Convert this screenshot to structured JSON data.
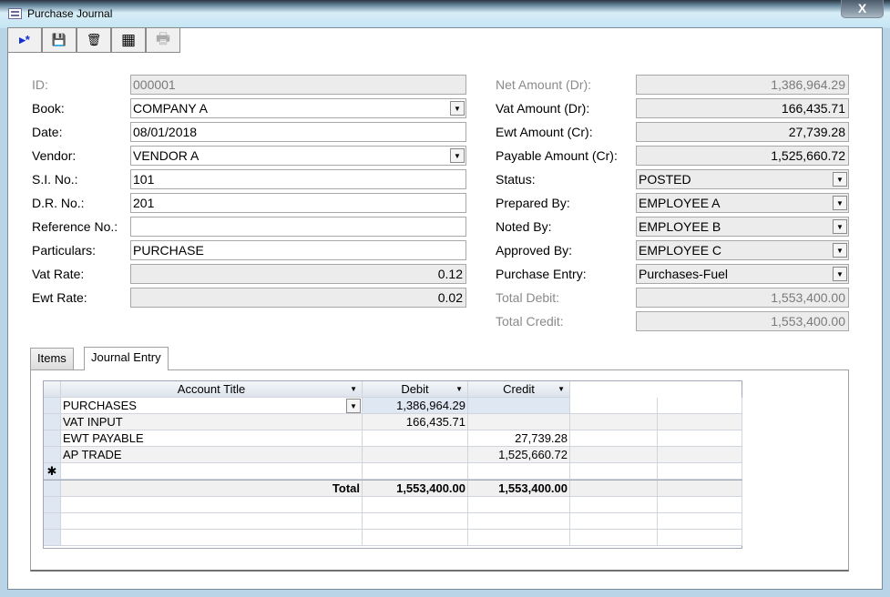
{
  "window": {
    "title": "Purchase Journal",
    "close": "X"
  },
  "toolbar": [
    {
      "name": "new-record",
      "glyph": "▸*"
    },
    {
      "name": "save",
      "glyph": "💾"
    },
    {
      "name": "delete",
      "glyph": "🗑"
    },
    {
      "name": "datasheet",
      "glyph": "▦"
    },
    {
      "name": "print",
      "glyph": "🖶"
    }
  ],
  "left": {
    "id": {
      "label": "ID:",
      "value": "000001"
    },
    "book": {
      "label": "Book:",
      "value": "COMPANY A"
    },
    "date": {
      "label": "Date:",
      "value": "08/01/2018"
    },
    "vendor": {
      "label": "Vendor:",
      "value": "VENDOR A"
    },
    "si": {
      "label": "S.I. No.:",
      "value": "101"
    },
    "dr": {
      "label": "D.R. No.:",
      "value": "201"
    },
    "ref": {
      "label": "Reference No.:",
      "value": ""
    },
    "particulars": {
      "label": "Particulars:",
      "value": "PURCHASE"
    },
    "vat": {
      "label": "Vat Rate:",
      "value": "0.12"
    },
    "ewt": {
      "label": "Ewt Rate:",
      "value": "0.02"
    }
  },
  "right": {
    "net": {
      "label": "Net Amount (Dr):",
      "value": "1,386,964.29"
    },
    "vat": {
      "label": "Vat Amount (Dr):",
      "value": "166,435.71"
    },
    "ewt": {
      "label": "Ewt Amount (Cr):",
      "value": "27,739.28"
    },
    "payable": {
      "label": "Payable Amount (Cr):",
      "value": "1,525,660.72"
    },
    "status": {
      "label": "Status:",
      "value": "POSTED"
    },
    "prepared": {
      "label": "Prepared By:",
      "value": "EMPLOYEE A"
    },
    "noted": {
      "label": "Noted By:",
      "value": "EMPLOYEE B"
    },
    "approved": {
      "label": "Approved By:",
      "value": "EMPLOYEE C"
    },
    "entry": {
      "label": "Purchase Entry:",
      "value": "Purchases-Fuel"
    },
    "tdebit": {
      "label": "Total Debit:",
      "value": "1,553,400.00"
    },
    "tcredit": {
      "label": "Total Credit:",
      "value": "1,553,400.00"
    }
  },
  "tabs": {
    "items": "Items",
    "journal": "Journal Entry"
  },
  "grid": {
    "headers": {
      "account": "Account Title",
      "debit": "Debit",
      "credit": "Credit"
    },
    "rows": [
      {
        "account": "PURCHASES",
        "debit": "1,386,964.29",
        "credit": ""
      },
      {
        "account": "VAT INPUT",
        "debit": "166,435.71",
        "credit": ""
      },
      {
        "account": "EWT PAYABLE",
        "debit": "",
        "credit": "27,739.28"
      },
      {
        "account": "AP TRADE",
        "debit": "",
        "credit": "1,525,660.72"
      }
    ],
    "new_row_marker": "✱",
    "total": {
      "label": "Total",
      "debit": "1,553,400.00",
      "credit": "1,553,400.00"
    }
  }
}
